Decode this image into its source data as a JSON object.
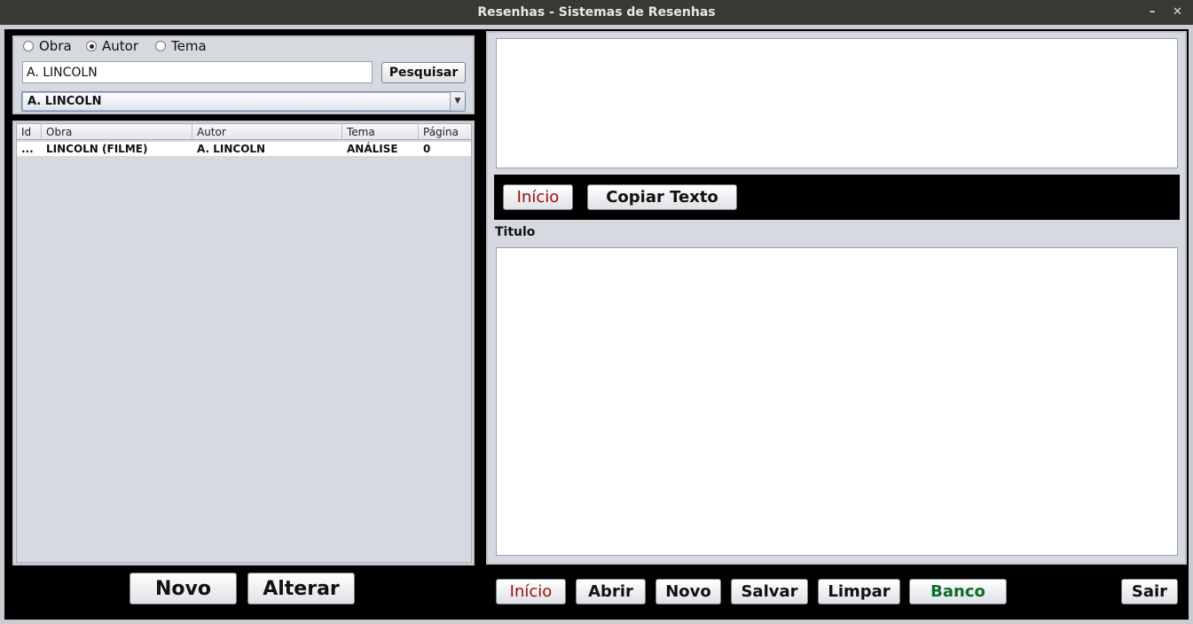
{
  "window": {
    "title": "Resenhas - Sistemas de Resenhas",
    "minimize_glyph": "–",
    "close_glyph": "✕"
  },
  "search": {
    "options": [
      "Obra",
      "Autor",
      "Tema"
    ],
    "selected": "Autor",
    "query": "A. LINCOLN",
    "button_label": "Pesquisar",
    "combo_value": "A. LINCOLN"
  },
  "table": {
    "columns": [
      "Id",
      "Obra",
      "Autor",
      "Tema",
      "Página"
    ],
    "rows": [
      [
        "...",
        "LINCOLN (FILME)",
        "A. LINCOLN",
        "ANÁLISE",
        "0"
      ]
    ]
  },
  "left_actions": {
    "novo": "Novo",
    "alterar": "Alterar"
  },
  "editor": {
    "inicio": "Início",
    "copiar": "Copiar Texto",
    "titulo_label": "Titulo"
  },
  "bottom_toolbar": {
    "inicio": "Início",
    "abrir": "Abrir",
    "novo": "Novo",
    "salvar": "Salvar",
    "limpar": "Limpar",
    "banco": "Banco",
    "sair": "Sair"
  },
  "colors": {
    "accent_red": "#9b0d0d",
    "accent_green": "#0d6b2a",
    "panel_grey": "#d6d9df"
  }
}
